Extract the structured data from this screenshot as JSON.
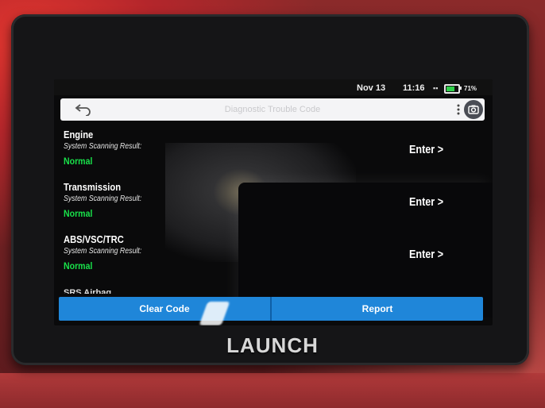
{
  "status_bar": {
    "date": "Nov 13",
    "time": "11:16",
    "battery_percent_text": "71%",
    "battery_level": 0.71
  },
  "title_bar": {
    "back_icon": "back-arrow-icon",
    "title": "Diagnostic Trouble Code",
    "menu_icon": "more-vertical-icon",
    "camera_icon": "camera-icon"
  },
  "systems": [
    {
      "name": "Engine",
      "result_label": "System Scanning Result:",
      "result": "Normal",
      "action": "Enter >"
    },
    {
      "name": "Transmission",
      "result_label": "System Scanning Result:",
      "result": "Normal",
      "action": "Enter >"
    },
    {
      "name": "ABS/VSC/TRC",
      "result_label": "System Scanning Result:",
      "result": "Normal",
      "action": "Enter >"
    }
  ],
  "partial_row": "SRS Airbag",
  "actions": {
    "clear_code": "Clear Code",
    "report": "Report"
  },
  "device": {
    "brand": "LAUNCH"
  },
  "colors": {
    "accent_blue": "#1f86d9",
    "status_green": "#19e04a"
  }
}
